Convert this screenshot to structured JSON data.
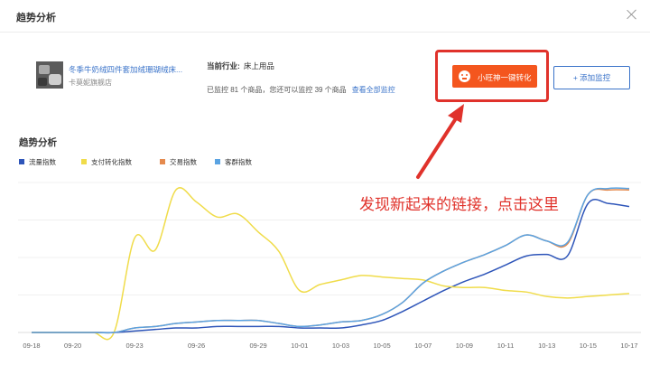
{
  "modal": {
    "title": "趋势分析"
  },
  "product": {
    "name": "冬季牛奶绒四件套加绒珊瑚绒床...",
    "shop": "卡莫妮旗舰店"
  },
  "industry": {
    "label": "当前行业:",
    "value": "床上用品"
  },
  "monitor": {
    "text": "已监控 81 个商品，您还可以监控 39 个商品",
    "link": "查看全部监控"
  },
  "actions": {
    "one_click_label": "小旺神一键转化",
    "add_monitor_label": "+ 添加监控"
  },
  "annotation": {
    "callout": "发现新起来的链接，点击这里"
  },
  "colors": {
    "accent_orange": "#f4561e",
    "highlight_red": "#e0322b",
    "link_blue": "#3a73c9"
  },
  "chart_data": {
    "type": "line",
    "title": "趋势分析",
    "x": [
      "09-18",
      "09-19",
      "09-20",
      "09-21",
      "09-22",
      "09-23",
      "09-24",
      "09-25",
      "09-26",
      "09-27",
      "09-28",
      "09-29",
      "09-30",
      "10-01",
      "10-02",
      "10-03",
      "10-04",
      "10-05",
      "10-06",
      "10-07",
      "10-08",
      "10-09",
      "10-10",
      "10-11",
      "10-12",
      "10-13",
      "10-14",
      "10-15",
      "10-16",
      "10-17"
    ],
    "tick_labels": [
      "09-18",
      "09-20",
      "09-23",
      "09-26",
      "09-29",
      "10-01",
      "10-03",
      "10-05",
      "10-07",
      "10-09",
      "10-11",
      "10-13",
      "10-15",
      "10-17"
    ],
    "ylim": [
      0,
      100
    ],
    "grid": true,
    "legend_position": "top-left",
    "series": [
      {
        "name": "流量指数",
        "color": "#2e55b9",
        "values": [
          0,
          0,
          0,
          0,
          0,
          1,
          2,
          3,
          3,
          4,
          4,
          4,
          4,
          3,
          3,
          3,
          5,
          8,
          14,
          21,
          28,
          34,
          39,
          45,
          51,
          52,
          51,
          86,
          86,
          84
        ]
      },
      {
        "name": "支付转化指数",
        "color": "#f0dc4a",
        "values": [
          0,
          0,
          0,
          0,
          0,
          63,
          55,
          95,
          87,
          77,
          79,
          67,
          54,
          28,
          32,
          35,
          38,
          37,
          36,
          35,
          31,
          30,
          30,
          28,
          27,
          24,
          23,
          24,
          25,
          26
        ]
      },
      {
        "name": "交易指数",
        "color": "#e58a4e",
        "values": [
          0,
          0,
          0,
          0,
          0,
          3,
          4,
          6,
          7,
          8,
          8,
          8,
          6,
          4,
          5,
          7,
          8,
          12,
          20,
          33,
          41,
          47,
          52,
          58,
          65,
          61,
          59,
          92,
          95,
          95
        ]
      },
      {
        "name": "客群指数",
        "color": "#5aa3e2",
        "values": [
          0,
          0,
          0,
          0,
          0,
          3,
          4,
          6,
          7,
          8,
          8,
          8,
          6,
          4,
          5,
          7,
          8,
          12,
          20,
          33,
          41,
          47,
          52,
          58,
          65,
          61,
          60,
          92,
          96,
          96
        ]
      }
    ]
  }
}
